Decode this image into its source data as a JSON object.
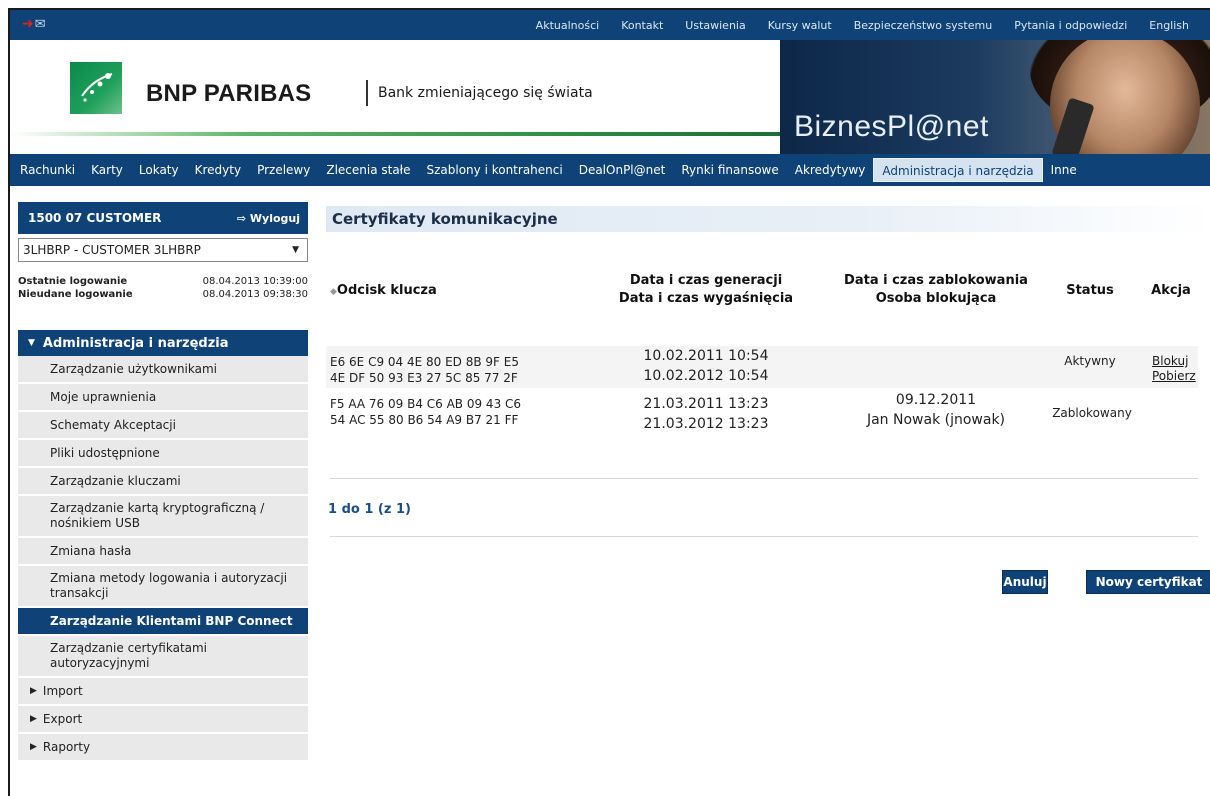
{
  "topbar": {
    "nav": [
      "Aktualności",
      "Kontakt",
      "Ustawienia",
      "Kursy walut",
      "Bezpieczeństwo systemu",
      "Pytania i odpowiedzi",
      "English"
    ]
  },
  "header": {
    "brand": "BNP PARIBAS",
    "tagline": "Bank zmieniającego się świata",
    "product": "BiznesPl@net"
  },
  "mainnav": {
    "items": [
      "Rachunki",
      "Karty",
      "Lokaty",
      "Kredyty",
      "Przelewy",
      "Zlecenia stałe",
      "Szablony i kontrahenci",
      "DealOnPl@net",
      "Rynki finansowe",
      "Akredytywy",
      "Administracja i narzędzia",
      "Inne"
    ],
    "active": "Administracja i narzędzia"
  },
  "sidebar": {
    "user": "1500 07 CUSTOMER",
    "logout": "Wyloguj",
    "account": "3LHBRP - CUSTOMER 3LHBRP",
    "last_login_label": "Ostatnie logowanie",
    "last_login_value": "08.04.2013 10:39:00",
    "failed_login_label": "Nieudane logowanie",
    "failed_login_value": "08.04.2013 09:38:30",
    "menu_head": "Administracja i narzędzia",
    "menu": [
      "Zarządzanie użytkownikami",
      "Moje uprawnienia",
      "Schematy Akceptacji",
      "Pliki udostępnione",
      "Zarządzanie kluczami",
      "Zarządzanie kartą kryptograficzną / nośnikiem USB",
      "Zmiana hasła",
      "Zmiana metody logowania i autoryzacji transakcji",
      "Zarządzanie Klientami BNP Connect",
      "Zarządzanie certyfikatami autoryzacyjnymi"
    ],
    "active_item": "Zarządzanie Klientami BNP Connect",
    "submenus": [
      "Import",
      "Export",
      "Raporty"
    ]
  },
  "content": {
    "title": "Certyfikaty komunikacyjne",
    "headers": {
      "fingerprint": "Odcisk klucza",
      "generated_1": "Data i czas generacji",
      "generated_2": "Data i czas wygaśnięcia",
      "blocked_1": "Data i czas zablokowania",
      "blocked_2": "Osoba blokująca",
      "status": "Status",
      "action": "Akcja"
    },
    "rows": [
      {
        "fp1": "E6 6E C9 04 4E 80 ED 8B 9F E5",
        "fp2": "4E DF 50 93 E3 27 5C 85 77 2F",
        "generated": "10.02.2011 10:54",
        "expires": "10.02.2012 10:54",
        "blocked_date": "",
        "blocked_by": "",
        "status": "Aktywny",
        "actions": [
          "Blokuj",
          "Pobierz"
        ]
      },
      {
        "fp1": "F5 AA 76 09 B4 C6 AB 09 43 C6",
        "fp2": "54 AC 55 80 B6 54 A9 B7 21 FF",
        "generated": "21.03.2011 13:23",
        "expires": "21.03.2012 13:23",
        "blocked_date": "09.12.2011",
        "blocked_by": "Jan Nowak (jnowak)",
        "status": "Zablokowany",
        "actions": []
      }
    ],
    "pager": "1 do 1 (z 1)",
    "cancel": "Anuluj",
    "new_cert": "Nowy certyfikat"
  }
}
